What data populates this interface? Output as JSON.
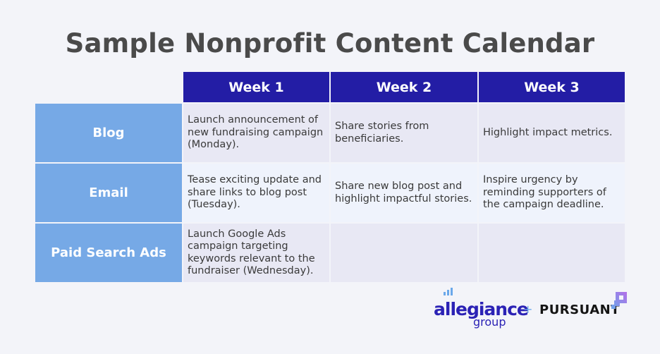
{
  "title": "Sample Nonprofit Content Calendar",
  "colors": {
    "header_bg": "#231da5",
    "label_bg": "#76a9e6",
    "row_odd_bg": "#e8e8f4",
    "row_even_bg": "#eff3fc",
    "title_text": "#4a4a4a",
    "brand_allegiance": "#2b22b5",
    "brand_accent": "#6aa8ea",
    "brand_pursuant_mark": "#a070e8"
  },
  "table": {
    "columns": [
      "Week 1",
      "Week 2",
      "Week 3"
    ],
    "rows": [
      {
        "label": "Blog",
        "cells": [
          "Launch announcement of new fundraising campaign (Monday).",
          "Share stories from beneficiaries.",
          "Highlight impact metrics."
        ]
      },
      {
        "label": "Email",
        "cells": [
          "Tease exciting update and share links to blog post (Tuesday).",
          "Share new blog post and highlight impactful stories.",
          "Inspire urgency by reminding supporters of the campaign deadline."
        ]
      },
      {
        "label": "Paid Search Ads",
        "cells": [
          "Launch Google Ads campaign targeting keywords relevant to the fundraiser (Wednesday).",
          "",
          ""
        ]
      }
    ]
  },
  "logos": {
    "allegiance_word": "allegiance",
    "allegiance_sub": "group",
    "separator": "+",
    "pursuant_word": "PURSUANT",
    "pursuant_icon": "pursuant-square-mark-icon"
  }
}
